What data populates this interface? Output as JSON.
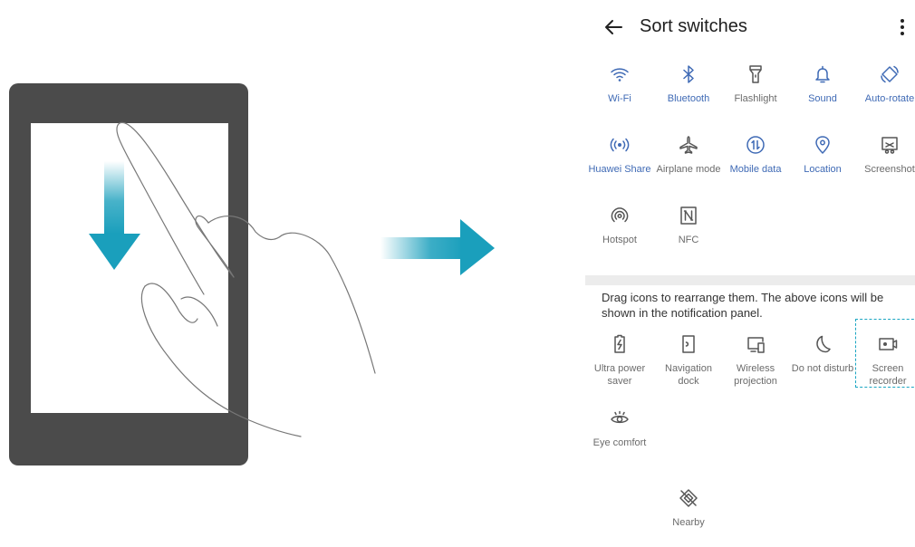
{
  "settings": {
    "title": "Sort switches",
    "hint": "Drag icons to rearrange them. The above icons will be shown in the notification panel.",
    "active": [
      {
        "label": "Wi-Fi",
        "icon": "wifi-icon",
        "on": true
      },
      {
        "label": "Bluetooth",
        "icon": "bluetooth-icon",
        "on": true
      },
      {
        "label": "Flashlight",
        "icon": "flashlight-icon",
        "on": false
      },
      {
        "label": "Sound",
        "icon": "bell-icon",
        "on": true
      },
      {
        "label": "Auto-rotate",
        "icon": "auto-rotate-icon",
        "on": true
      },
      {
        "label": "Huawei Share",
        "icon": "huawei-share-icon",
        "on": true
      },
      {
        "label": "Airplane mode",
        "icon": "airplane-icon",
        "on": false
      },
      {
        "label": "Mobile data",
        "icon": "mobile-data-icon",
        "on": true
      },
      {
        "label": "Location",
        "icon": "location-icon",
        "on": true
      },
      {
        "label": "Screenshot",
        "icon": "screenshot-icon",
        "on": false
      },
      {
        "label": "Hotspot",
        "icon": "hotspot-icon",
        "on": false
      },
      {
        "label": "NFC",
        "icon": "nfc-icon",
        "on": false
      }
    ],
    "inactive": [
      {
        "label": "Ultra power saver",
        "icon": "battery-icon"
      },
      {
        "label": "Navigation dock",
        "icon": "navigation-dock-icon"
      },
      {
        "label": "Wireless projection",
        "icon": "wireless-projection-icon"
      },
      {
        "label": "Do not disturb",
        "icon": "moon-icon"
      },
      {
        "label": "Screen recorder",
        "icon": "screen-recorder-icon"
      },
      {
        "label": "Eye comfort",
        "icon": "eye-icon"
      },
      {
        "label": "Nearby",
        "icon": "nearby-icon"
      }
    ]
  },
  "colors": {
    "active": "#3f6ab5",
    "inactive": "#555555",
    "highlight": "#1aa5c2",
    "arrow": "#1a9fbc",
    "device": "#4b4b4b"
  }
}
